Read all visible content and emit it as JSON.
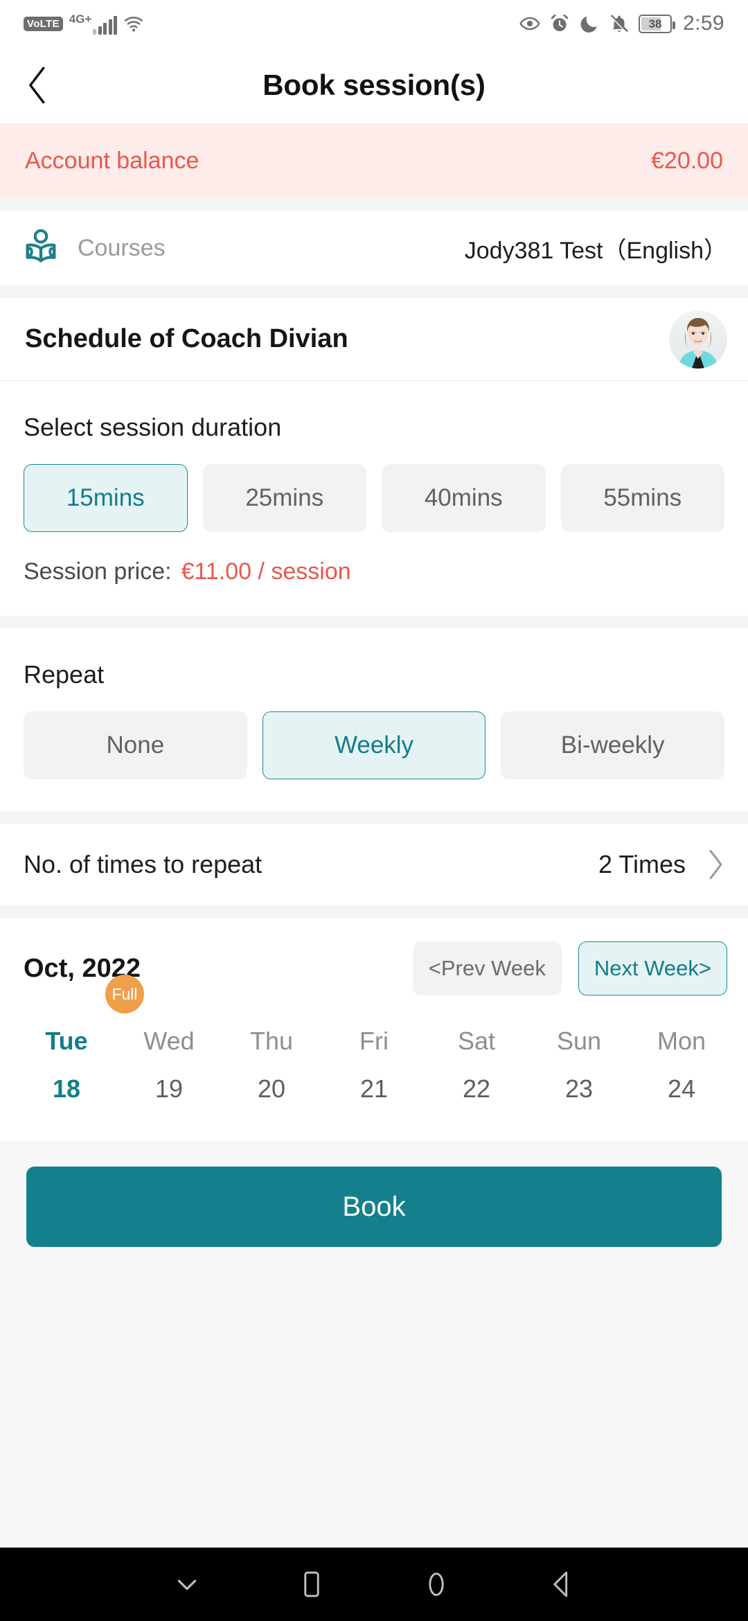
{
  "statusbar": {
    "volte": "VoLTE",
    "network": "4G+",
    "time": "2:59",
    "battery_percent": "38",
    "icons": [
      "eye-care-icon",
      "alarm-icon",
      "moon-icon",
      "bell-muted-icon",
      "battery-icon"
    ]
  },
  "appbar": {
    "title": "Book session(s)",
    "back_icon": "chevron-left-icon"
  },
  "balance": {
    "label": "Account balance",
    "value": "€20.00",
    "bg": "#fdece9",
    "fg": "#e8584e"
  },
  "courses": {
    "icon": "courses-reader-icon",
    "label": "Courses",
    "value": "Jody381 Test（English）"
  },
  "schedule": {
    "title": "Schedule of Coach Divian",
    "avatar": "coach-avatar"
  },
  "duration": {
    "title": "Select session duration",
    "options": [
      {
        "label": "15mins",
        "selected": true
      },
      {
        "label": "25mins",
        "selected": false
      },
      {
        "label": "40mins",
        "selected": false
      },
      {
        "label": "55mins",
        "selected": false
      }
    ],
    "price_label": "Session price:",
    "price_value": "€11.00 / session"
  },
  "repeat": {
    "title": "Repeat",
    "options": [
      {
        "label": "None",
        "selected": false
      },
      {
        "label": "Weekly",
        "selected": true
      },
      {
        "label": "Bi-weekly",
        "selected": false
      }
    ]
  },
  "repeat_count": {
    "label": "No. of times to repeat",
    "value": "2 Times",
    "chevron": "chevron-right-icon"
  },
  "calendar": {
    "month": "Oct, 2022",
    "prev_week": "<Prev Week",
    "next_week": "Next Week>",
    "days": [
      {
        "dow": "Tue",
        "date": "18",
        "selected": true,
        "badge": "Full"
      },
      {
        "dow": "Wed",
        "date": "19",
        "selected": false,
        "badge": ""
      },
      {
        "dow": "Thu",
        "date": "20",
        "selected": false,
        "badge": ""
      },
      {
        "dow": "Fri",
        "date": "21",
        "selected": false,
        "badge": ""
      },
      {
        "dow": "Sat",
        "date": "22",
        "selected": false,
        "badge": ""
      },
      {
        "dow": "Sun",
        "date": "23",
        "selected": false,
        "badge": ""
      },
      {
        "dow": "Mon",
        "date": "24",
        "selected": false,
        "badge": ""
      }
    ]
  },
  "footer": {
    "book_label": "Book",
    "accent": "#15808d"
  },
  "navbar": {
    "items": [
      "chevron-down-icon",
      "recents-square-icon",
      "home-circle-icon",
      "back-triangle-icon"
    ]
  }
}
